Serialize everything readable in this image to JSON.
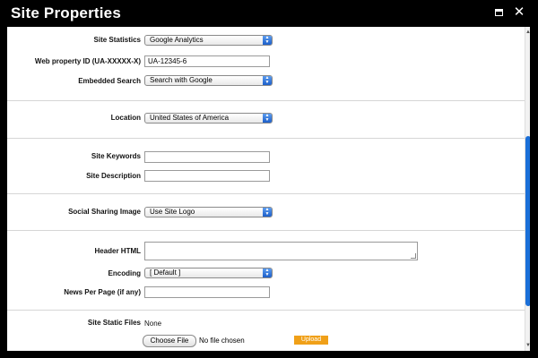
{
  "window": {
    "title": "Site Properties"
  },
  "icons": {
    "maximize": "window-maximize-icon",
    "close": "close-icon"
  },
  "form": {
    "site_statistics": {
      "label": "Site Statistics",
      "value": "Google Analytics"
    },
    "web_property_id": {
      "label": "Web property ID (UA-XXXXX-X)",
      "value": "UA-12345-6"
    },
    "embedded_search": {
      "label": "Embedded Search",
      "value": "Search with Google"
    },
    "location": {
      "label": "Location",
      "value": "United States of America"
    },
    "site_keywords": {
      "label": "Site Keywords",
      "value": ""
    },
    "site_description": {
      "label": "Site Description",
      "value": ""
    },
    "social_sharing_image": {
      "label": "Social Sharing Image",
      "value": "Use Site Logo"
    },
    "header_html": {
      "label": "Header HTML",
      "value": ""
    },
    "encoding": {
      "label": "Encoding",
      "value": "[ Default ]"
    },
    "news_per_page": {
      "label": "News Per Page (if any)",
      "value": ""
    },
    "site_static_files": {
      "label": "Site Static Files",
      "value": "None",
      "choose_label": "Choose File",
      "no_file_text": "No file chosen",
      "upload_label": "Upload"
    }
  },
  "colors": {
    "background": "#000000",
    "panel": "#ffffff",
    "accent": "#1a6fd8",
    "upload": "#f0a018"
  }
}
